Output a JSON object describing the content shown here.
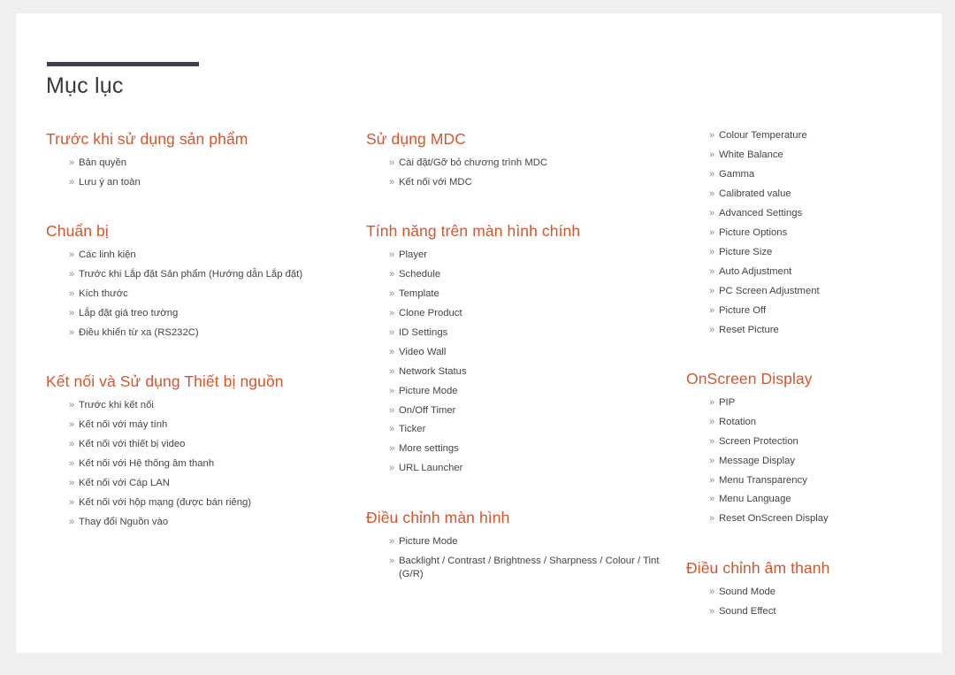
{
  "page": {
    "title": "Mục lục",
    "bullet_glyph": "»",
    "accent_color": "#d6552c",
    "rule_color": "#413f4b",
    "text_color": "#444449",
    "page_background": "#ffffff",
    "canvas_background": "#efefef"
  },
  "columns": [
    {
      "id": "column-1",
      "sections": [
        {
          "heading": "Trước khi sử dụng sản phẩm",
          "items": [
            "Bản quyền",
            "Lưu ý an toàn"
          ]
        },
        {
          "heading": "Chuẩn bị",
          "items": [
            "Các linh kiện",
            "Trước khi Lắp đặt Sản phẩm (Hướng dẫn Lắp đặt)",
            "Kích thước",
            "Lắp đặt giá treo tường",
            "Điều khiển từ xa (RS232C)"
          ]
        },
        {
          "heading": "Kết nối và Sử dụng Thiết bị nguồn",
          "items": [
            "Trước khi kết nối",
            "Kết nối với máy tính",
            "Kết nối với thiết bị video",
            "Kết nối với Hệ thống âm thanh",
            "Kết nối với Cáp LAN",
            "Kết nối với hộp mạng (được bán riêng)",
            "Thay đổi Nguồn vào"
          ]
        }
      ]
    },
    {
      "id": "column-2",
      "sections": [
        {
          "heading": "Sử dụng MDC",
          "items": [
            "Cài đặt/Gỡ bỏ chương trình MDC",
            "Kết nối với MDC"
          ]
        },
        {
          "heading": "Tính năng trên màn hình chính",
          "items": [
            "Player",
            "Schedule",
            "Template",
            "Clone Product",
            "ID Settings",
            "Video Wall",
            "Network Status",
            "Picture Mode",
            "On/Off Timer",
            "Ticker",
            "More settings",
            "URL Launcher"
          ]
        },
        {
          "heading": "Điều chỉnh màn hình",
          "items": [
            "Picture Mode",
            "Backlight / Contrast / Brightness / Sharpness / Colour / Tint (G/R)"
          ]
        }
      ]
    },
    {
      "id": "column-3",
      "sections": [
        {
          "heading": "",
          "continued": true,
          "items": [
            "Colour Temperature",
            "White Balance",
            "Gamma",
            "Calibrated value",
            "Advanced Settings",
            "Picture Options",
            "Picture Size",
            "Auto Adjustment",
            "PC Screen Adjustment",
            "Picture Off",
            "Reset Picture"
          ]
        },
        {
          "heading": "OnScreen Display",
          "items": [
            "PIP",
            "Rotation",
            "Screen Protection",
            "Message Display",
            "Menu Transparency",
            "Menu Language",
            "Reset OnScreen Display"
          ]
        },
        {
          "heading": "Điều chỉnh âm thanh",
          "items": [
            "Sound Mode",
            "Sound Effect"
          ]
        }
      ]
    }
  ]
}
